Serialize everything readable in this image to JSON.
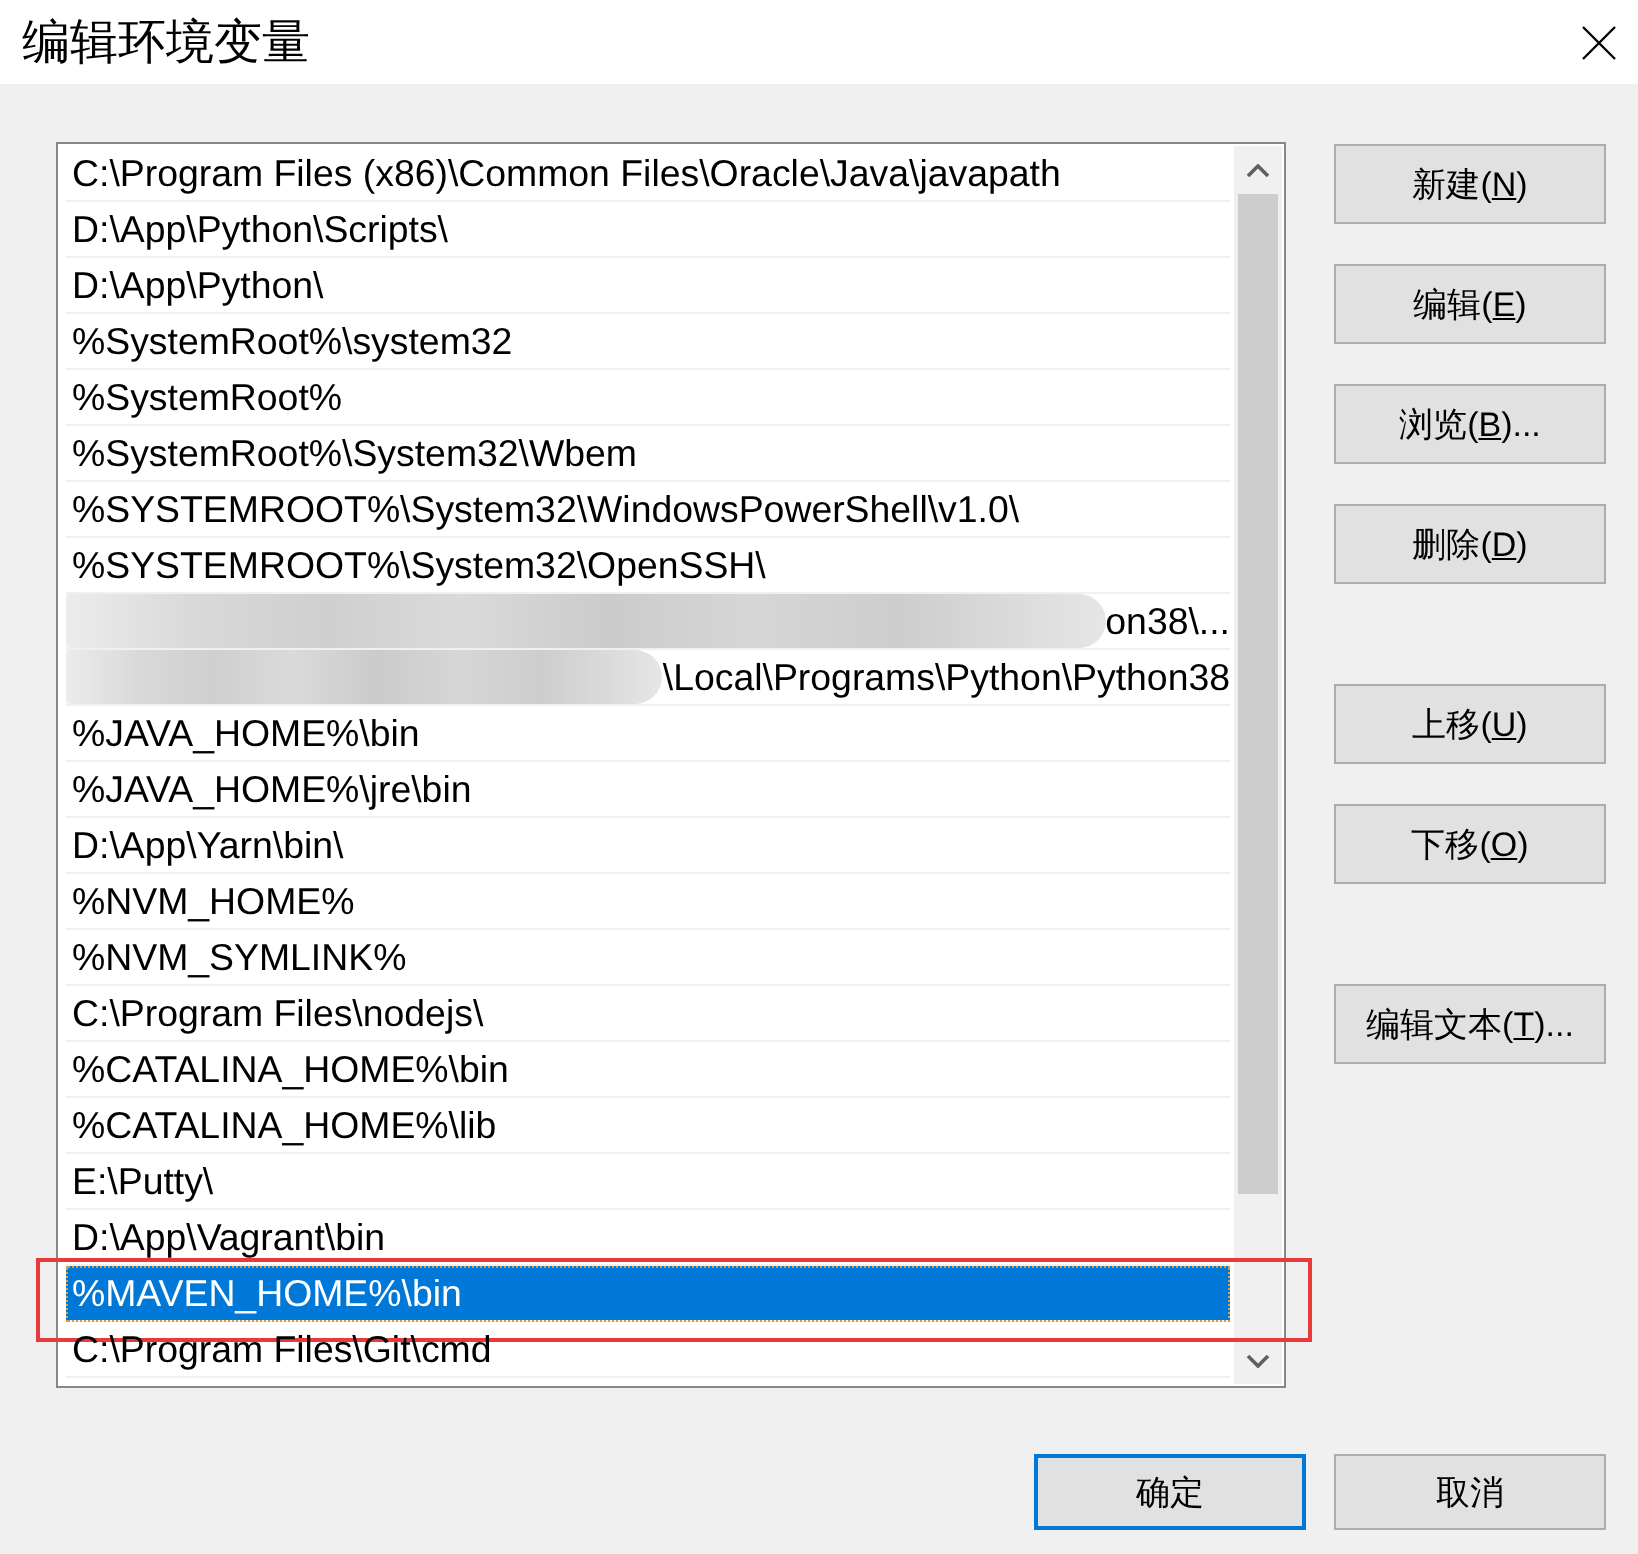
{
  "window": {
    "title": "编辑环境变量"
  },
  "path_list": {
    "entries": [
      {
        "text": "C:\\Program Files (x86)\\Common Files\\Oracle\\Java\\javapath",
        "selected": false,
        "highlighted": false,
        "redacted": false
      },
      {
        "text": "D:\\App\\Python\\Scripts\\",
        "selected": false,
        "highlighted": false,
        "redacted": false
      },
      {
        "text": "D:\\App\\Python\\",
        "selected": false,
        "highlighted": false,
        "redacted": false
      },
      {
        "text": "%SystemRoot%\\system32",
        "selected": false,
        "highlighted": false,
        "redacted": false
      },
      {
        "text": "%SystemRoot%",
        "selected": false,
        "highlighted": false,
        "redacted": false
      },
      {
        "text": "%SystemRoot%\\System32\\Wbem",
        "selected": false,
        "highlighted": false,
        "redacted": false
      },
      {
        "text": "%SYSTEMROOT%\\System32\\WindowsPowerShell\\v1.0\\",
        "selected": false,
        "highlighted": false,
        "redacted": false
      },
      {
        "text": "%SYSTEMROOT%\\System32\\OpenSSH\\",
        "selected": false,
        "highlighted": false,
        "redacted": false
      },
      {
        "text": "on38\\...",
        "selected": false,
        "highlighted": false,
        "redacted": true
      },
      {
        "text": "\\Local\\Programs\\Python\\Python38",
        "selected": false,
        "highlighted": false,
        "redacted": true
      },
      {
        "text": "%JAVA_HOME%\\bin",
        "selected": false,
        "highlighted": false,
        "redacted": false
      },
      {
        "text": "%JAVA_HOME%\\jre\\bin",
        "selected": false,
        "highlighted": false,
        "redacted": false
      },
      {
        "text": "D:\\App\\Yarn\\bin\\",
        "selected": false,
        "highlighted": false,
        "redacted": false
      },
      {
        "text": "%NVM_HOME%",
        "selected": false,
        "highlighted": false,
        "redacted": false
      },
      {
        "text": "%NVM_SYMLINK%",
        "selected": false,
        "highlighted": false,
        "redacted": false
      },
      {
        "text": "C:\\Program Files\\nodejs\\",
        "selected": false,
        "highlighted": false,
        "redacted": false
      },
      {
        "text": "%CATALINA_HOME%\\bin",
        "selected": false,
        "highlighted": false,
        "redacted": false
      },
      {
        "text": "%CATALINA_HOME%\\lib",
        "selected": false,
        "highlighted": false,
        "redacted": false
      },
      {
        "text": "E:\\Putty\\",
        "selected": false,
        "highlighted": false,
        "redacted": false
      },
      {
        "text": "D:\\App\\Vagrant\\bin",
        "selected": false,
        "highlighted": false,
        "redacted": false
      },
      {
        "text": "%MAVEN_HOME%\\bin",
        "selected": true,
        "highlighted": true,
        "redacted": false
      },
      {
        "text": "C:\\Program Files\\Git\\cmd",
        "selected": false,
        "highlighted": false,
        "redacted": false
      }
    ]
  },
  "side_button_groups": [
    {
      "buttons": [
        {
          "prefix": "新建(",
          "key": "N",
          "suffix": ")"
        },
        {
          "prefix": "编辑(",
          "key": "E",
          "suffix": ")"
        },
        {
          "prefix": "浏览(",
          "key": "B",
          "suffix": ")..."
        },
        {
          "prefix": "删除(",
          "key": "D",
          "suffix": ")"
        }
      ]
    },
    {
      "buttons": [
        {
          "prefix": "上移(",
          "key": "U",
          "suffix": ")"
        },
        {
          "prefix": "下移(",
          "key": "O",
          "suffix": ")"
        }
      ]
    },
    {
      "buttons": [
        {
          "prefix": "编辑文本(",
          "key": "T",
          "suffix": ")..."
        }
      ]
    }
  ],
  "footer_buttons": [
    {
      "label": "确定",
      "default": true
    },
    {
      "label": "取消",
      "default": false
    }
  ]
}
